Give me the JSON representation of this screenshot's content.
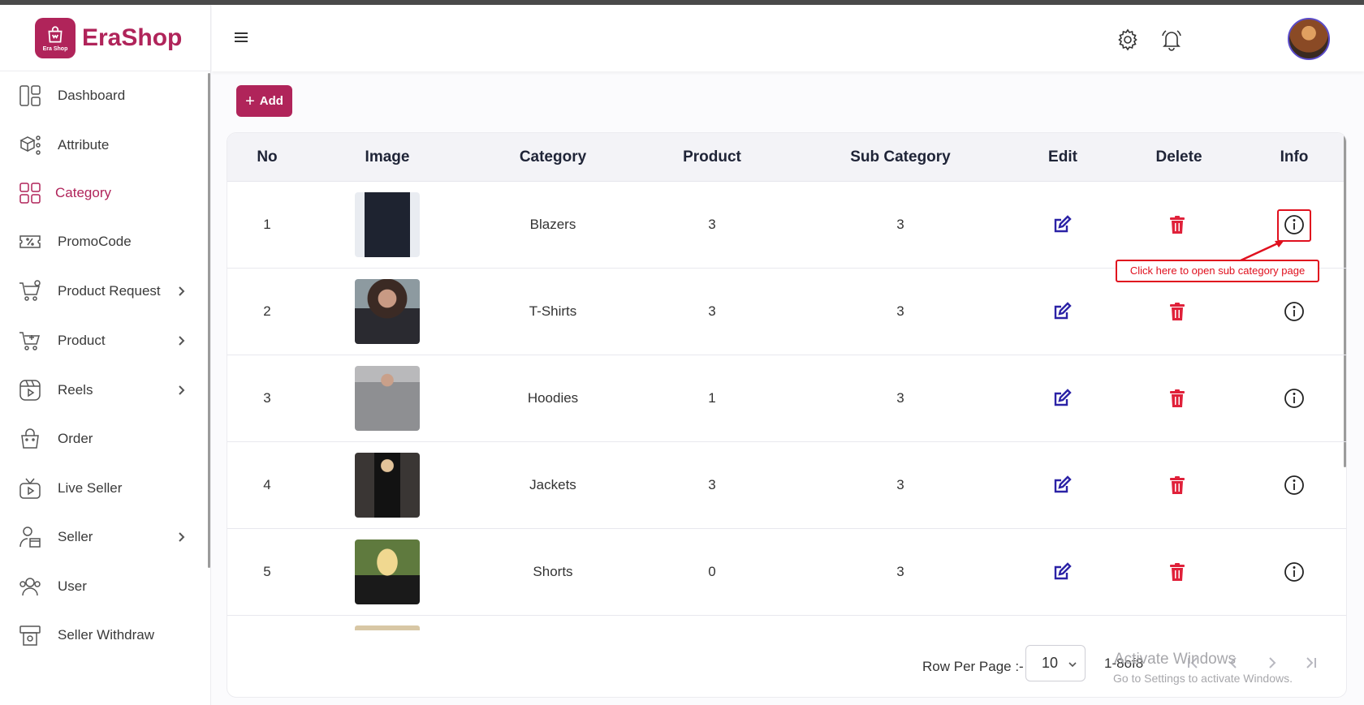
{
  "brand": {
    "name": "EraShop",
    "logo_text": "Era Shop",
    "color": "#b0245a"
  },
  "sidebar": {
    "items": [
      {
        "label": "Dashboard",
        "icon": "dashboard-icon"
      },
      {
        "label": "Attribute",
        "icon": "attribute-icon"
      },
      {
        "label": "Category",
        "icon": "category-icon",
        "active": true
      },
      {
        "label": "PromoCode",
        "icon": "promocode-icon"
      },
      {
        "label": "Product Request",
        "icon": "product-request-icon",
        "expandable": true
      },
      {
        "label": "Product",
        "icon": "product-icon",
        "expandable": true
      },
      {
        "label": "Reels",
        "icon": "reels-icon",
        "expandable": true
      },
      {
        "label": "Order",
        "icon": "order-icon"
      },
      {
        "label": "Live Seller",
        "icon": "live-seller-icon"
      },
      {
        "label": "Seller",
        "icon": "seller-icon",
        "expandable": true
      },
      {
        "label": "User",
        "icon": "user-icon"
      },
      {
        "label": "Seller Withdraw",
        "icon": "seller-withdraw-icon"
      }
    ]
  },
  "header": {
    "icons": [
      "hamburger-icon",
      "settings-icon",
      "notification-bell-icon",
      "avatar"
    ]
  },
  "toolbar": {
    "add_label": "Add",
    "add_icon": "+"
  },
  "table": {
    "columns": [
      "No",
      "Image",
      "Category",
      "Product",
      "Sub Category",
      "Edit",
      "Delete",
      "Info"
    ],
    "rows": [
      {
        "no": "1",
        "category": "Blazers",
        "product": "3",
        "sub_category": "3"
      },
      {
        "no": "2",
        "category": "T-Shirts",
        "product": "3",
        "sub_category": "3"
      },
      {
        "no": "3",
        "category": "Hoodies",
        "product": "1",
        "sub_category": "3"
      },
      {
        "no": "4",
        "category": "Jackets",
        "product": "3",
        "sub_category": "3"
      },
      {
        "no": "5",
        "category": "Shorts",
        "product": "0",
        "sub_category": "3"
      }
    ],
    "edit_color": "#2b22a6",
    "delete_color": "#e0213a"
  },
  "annotation": {
    "text": "Click here to open sub category page",
    "color": "#e0101e"
  },
  "pagination": {
    "rows_per_page_label": "Row Per Page :-",
    "rows_per_page": "10",
    "range_text": "1-8of8"
  },
  "watermark": {
    "line1": "Activate Windows",
    "line2": "Go to Settings to activate Windows."
  }
}
